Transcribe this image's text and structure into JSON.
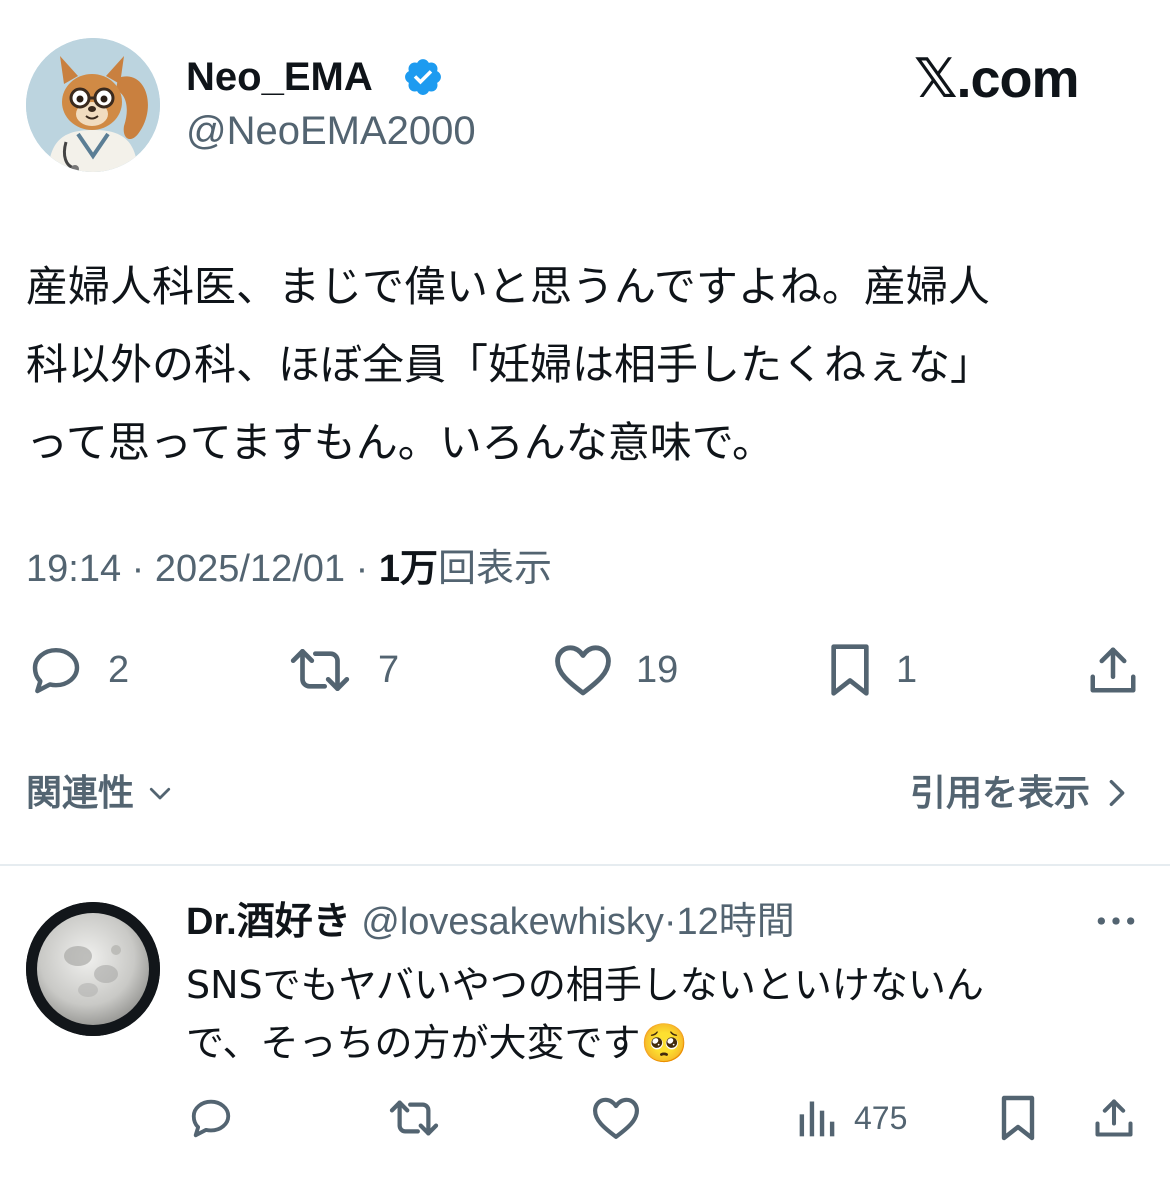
{
  "header": {
    "display_name": "Neo_EMA",
    "handle": "@NeoEMA2000",
    "brand": "𝕏.com",
    "avatar_icon": "squirrel-doctor-avatar",
    "verified_icon": "verified-badge-icon",
    "verified_color": "#1d9bf0"
  },
  "tweet": {
    "text": "産婦人科医、まじで偉いと思うんですよね。産婦人\n科以外の科、ほぼ全員「妊婦は相手したくねぇな」\nって思ってますもん。いろんな意味で。",
    "time": "19:14",
    "date": "2025/12/01",
    "views_number": "1万",
    "views_label": "回表示",
    "separator": "·"
  },
  "actions": {
    "reply_count": "2",
    "retweet_count": "7",
    "like_count": "19",
    "bookmark_count": "1"
  },
  "footer": {
    "related_label": "関連性",
    "quotes_label": "引用を表示"
  },
  "reply": {
    "name": "Dr.酒好き",
    "handle": "@lovesakewhisky",
    "separator": "·",
    "time": "12時間",
    "text": "SNSでもヤバいやつの相手しないといけないん\nで、そっちの方が大変です",
    "emoji": "🥺",
    "views_count": "475",
    "avatar_icon": "moon-avatar"
  }
}
